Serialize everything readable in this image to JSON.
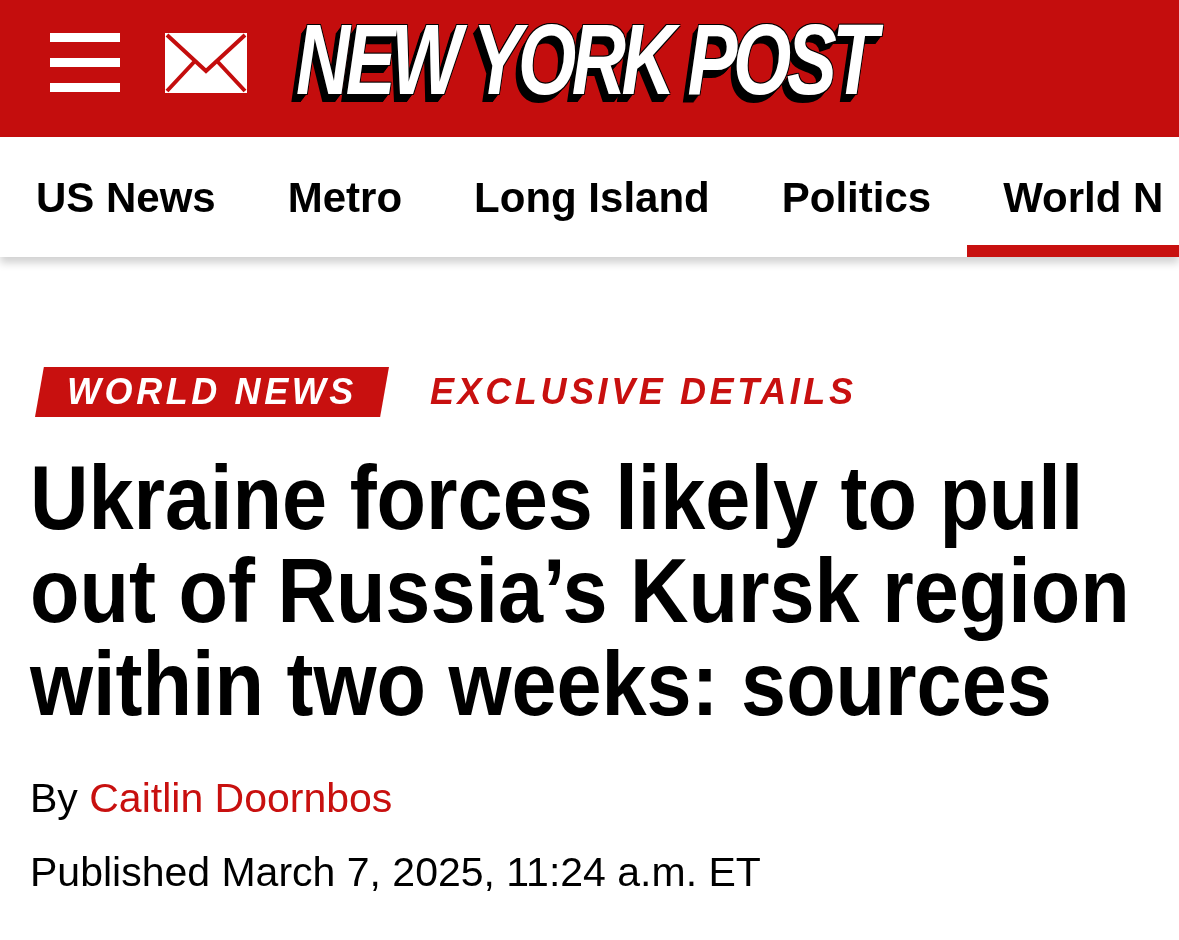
{
  "header": {
    "logo": "NEW YORK POST"
  },
  "nav": {
    "tabs": [
      {
        "label": "US News",
        "selected": false
      },
      {
        "label": "Metro",
        "selected": false
      },
      {
        "label": "Long Island",
        "selected": false
      },
      {
        "label": "Politics",
        "selected": false
      },
      {
        "label": "World N",
        "selected": true
      }
    ]
  },
  "article": {
    "section_tag": "WORLD NEWS",
    "kicker": "EXCLUSIVE DETAILS",
    "headline": "Ukraine forces likely to pull out of Russia’s Kursk region within two weeks: sources",
    "byline": {
      "prefix": "By",
      "author": "Caitlin Doornbos"
    },
    "published": "Published March 7, 2025, 11:24 a.m. ET"
  }
}
